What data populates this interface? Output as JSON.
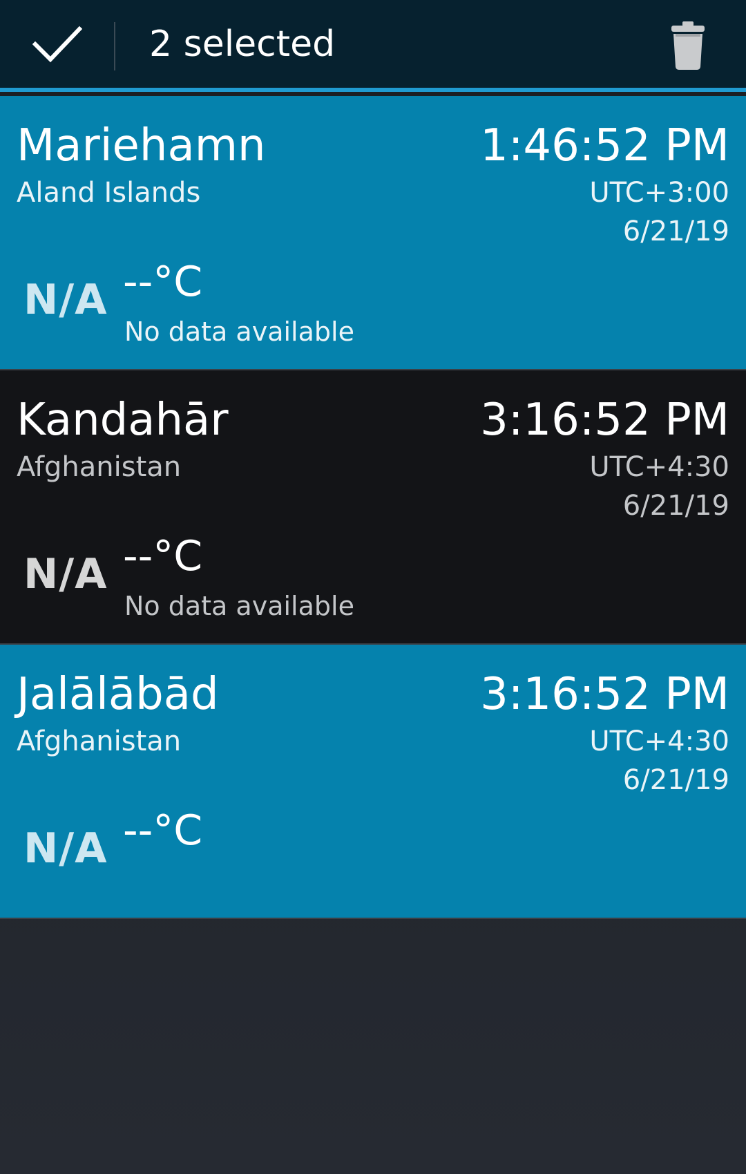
{
  "action_bar": {
    "selected_label": "2 selected",
    "done_icon": "checkmark-icon",
    "delete_icon": "trash-icon",
    "accent_color": "#1f9bd1",
    "background_color": "#06212f"
  },
  "cities": [
    {
      "name": "Mariehamn",
      "country": "Aland Islands",
      "time": "1:46:52 PM",
      "utc_offset": "UTC+3:00",
      "date": "6/21/19",
      "weather_icon_text": "N/A",
      "temperature": "--°C",
      "condition": "No data available",
      "selected": true
    },
    {
      "name": "Kandahār",
      "country": "Afghanistan",
      "time": "3:16:52 PM",
      "utc_offset": "UTC+4:30",
      "date": "6/21/19",
      "weather_icon_text": "N/A",
      "temperature": "--°C",
      "condition": "No data available",
      "selected": false
    },
    {
      "name": "Jalālābād",
      "country": "Afghanistan",
      "time": "3:16:52 PM",
      "utc_offset": "UTC+4:30",
      "date": "6/21/19",
      "weather_icon_text": "N/A",
      "temperature": "--°C",
      "condition": "",
      "selected": true
    }
  ],
  "colors": {
    "selected_row": "#0582ad",
    "normal_row": "#131417"
  }
}
